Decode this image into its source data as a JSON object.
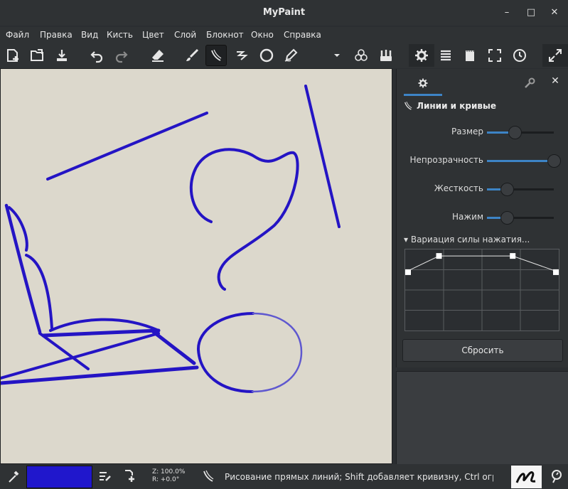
{
  "window": {
    "title": "MyPaint",
    "minimize_label": "–",
    "maximize_label": "□",
    "close_label": "✕"
  },
  "menu": {
    "items": [
      "Файл",
      "Правка",
      "Вид",
      "Кисть",
      "Цвет",
      "Слой",
      "Блокнот",
      "Окно",
      "Справка"
    ]
  },
  "toolbar": {
    "icons": [
      "new-document-icon",
      "open-folder-icon",
      "save-icon",
      "undo-icon",
      "redo-icon",
      "eraser-icon",
      "brush-icon",
      "lines-curves-icon",
      "freehand-icon",
      "ellipse-icon",
      "ink-pen-icon",
      "dropdown-icon",
      "color-circles-icon",
      "brushes-icon",
      "settings-icon",
      "layers-icon",
      "scratchpad-icon",
      "fullscreen-icon",
      "history-icon",
      "expand-icon"
    ]
  },
  "panel": {
    "tab_icon": "gear-icon",
    "title": "Линии и кривые",
    "sliders": [
      {
        "label": "Размер",
        "value": 0.42
      },
      {
        "label": "Непрозрачность",
        "value": 1.0
      },
      {
        "label": "Жесткость",
        "value": 0.3
      },
      {
        "label": "Нажим",
        "value": 0.3
      }
    ],
    "curve_header": "Вариация силы нажатия...",
    "curve_points": [
      [
        0.0,
        0.72
      ],
      [
        0.22,
        0.92
      ],
      [
        0.7,
        0.92
      ],
      [
        1.0,
        0.72
      ]
    ],
    "reset_label": "Сбросить"
  },
  "status": {
    "color": "#2017cc",
    "zoom_line": "Z: 100.0%",
    "rotation_line": "R: +0.0°",
    "message": "Рисование прямых линий; Shift добавляет кривизну, Ctrl огра..."
  },
  "colors": {
    "stroke": "#2414c4",
    "accent": "#3d84c6",
    "canvas": "#dcd8cc"
  }
}
